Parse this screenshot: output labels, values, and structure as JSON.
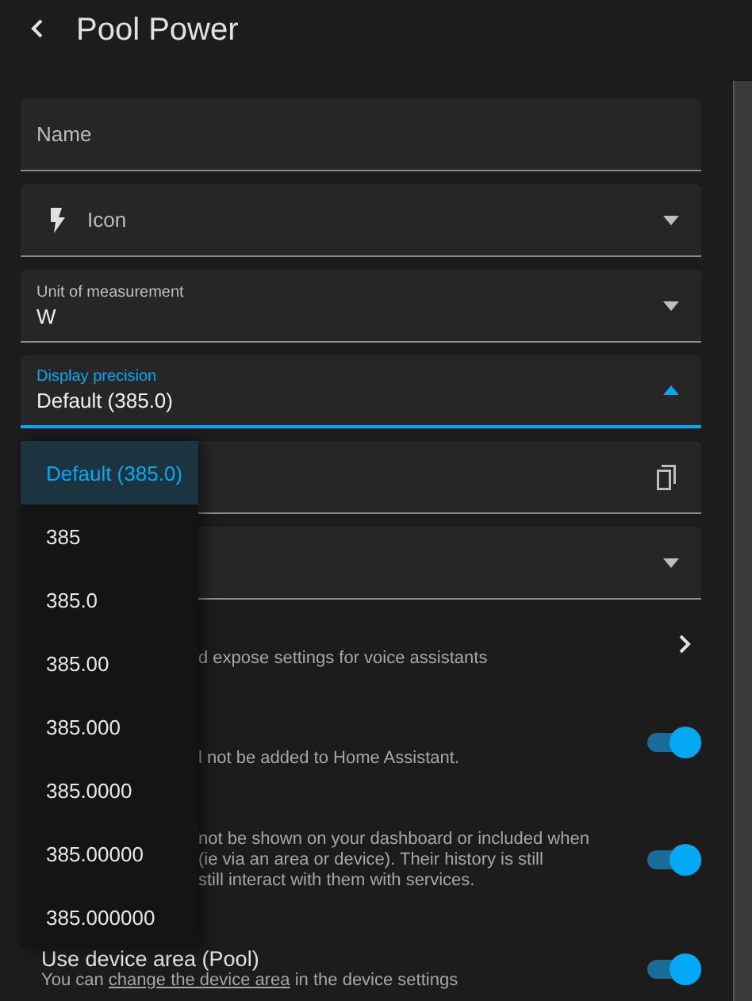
{
  "header": {
    "title": "Pool Power"
  },
  "fields": [
    {
      "kind": "text",
      "label": "Name"
    },
    {
      "kind": "icon-select",
      "label": "Icon"
    },
    {
      "kind": "select",
      "label": "Unit of measurement",
      "value": "W",
      "focused": false
    },
    {
      "kind": "select",
      "label": "Display precision",
      "value": "Default (385.0)",
      "focused": true
    },
    {
      "kind": "copy"
    },
    {
      "kind": "select"
    }
  ],
  "menu": {
    "items": [
      {
        "label": "Default (385.0)",
        "selected": true
      },
      {
        "label": "385",
        "selected": false
      },
      {
        "label": "385.0",
        "selected": false
      },
      {
        "label": "385.00",
        "selected": false
      },
      {
        "label": "385.000",
        "selected": false
      },
      {
        "label": "385.0000",
        "selected": false
      },
      {
        "label": "385.00000",
        "selected": false
      },
      {
        "label": "385.000000",
        "selected": false
      }
    ]
  },
  "settings": [
    {
      "kind": "link",
      "lines": [
        "d expose settings for voice assistants"
      ]
    },
    {
      "kind": "toggle",
      "on": true,
      "lines": [
        "l not be added to Home Assistant."
      ]
    },
    {
      "kind": "toggle",
      "on": true,
      "lines": [
        "not be shown on your dashboard or included when",
        "(ie via an area or device). Their history is still",
        "still interact with them with services."
      ]
    },
    {
      "kind": "toggle",
      "on": true,
      "title": "Use device area (Pool)",
      "before": "You can",
      "link": "change the device area",
      "after": "in the device settings"
    }
  ]
}
